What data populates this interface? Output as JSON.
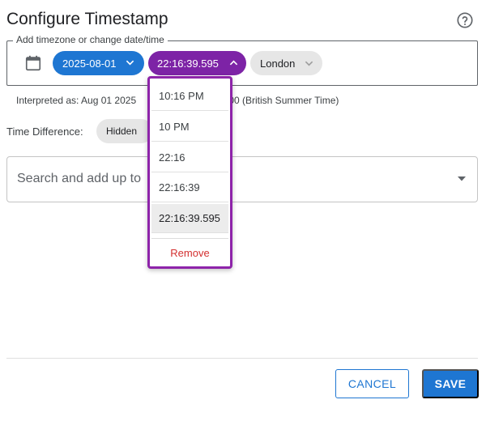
{
  "dialog": {
    "title": "Configure Timestamp",
    "help_icon": "help-circle-icon"
  },
  "timestamp_field": {
    "legend": "Add timezone or change date/time",
    "calendar_icon": "calendar-icon",
    "date_chip": "2025-08-01",
    "time_chip": "22:16:39.595",
    "timezone_chip": "London"
  },
  "interpreted": {
    "left_text": "Interpreted as: Aug 01 2025",
    "right_text": ":00 (British Summer Time)"
  },
  "time_difference": {
    "label": "Time Difference:",
    "value": "Hidden"
  },
  "search": {
    "placeholder": "Search and add up to"
  },
  "time_format_menu": {
    "items": [
      "10:16 PM",
      "10 PM",
      "22:16",
      "22:16:39",
      "22:16:39.595"
    ],
    "selected_index": 4,
    "remove_label": "Remove"
  },
  "actions": {
    "cancel_label": "CANCEL",
    "save_label": "SAVE"
  },
  "colors": {
    "primary": "#1e76d2",
    "time_chip": "#7d23a6",
    "menu_border": "#8e24aa",
    "remove": "#d32f2f"
  }
}
